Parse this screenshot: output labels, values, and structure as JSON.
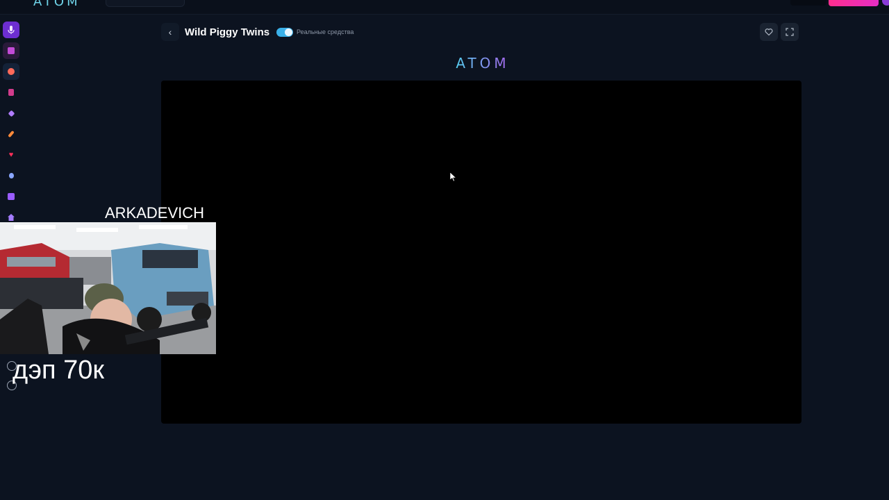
{
  "topbar": {
    "logo_text": "ATOM"
  },
  "sidebar": {
    "items": [
      {
        "icon": "mic-icon",
        "color": "#c9a3ff"
      },
      {
        "icon": "slots-icon",
        "color": "#c24bd6"
      },
      {
        "icon": "globe-icon",
        "color": "#ff6a5a"
      },
      {
        "icon": "cards-icon",
        "color": "#d23c8c"
      },
      {
        "icon": "gem-icon",
        "color": "#b07cff"
      },
      {
        "icon": "rocket-icon",
        "color": "#ff8a3a"
      },
      {
        "icon": "heart-icon",
        "color": "#ff2f5a"
      },
      {
        "icon": "potion-icon",
        "color": "#8aa6ff"
      },
      {
        "icon": "dice-icon",
        "color": "#9a5cff"
      },
      {
        "icon": "home-icon",
        "color": "#a47cff"
      }
    ]
  },
  "game": {
    "back_icon": "‹",
    "title": "Wild Piggy Twins",
    "real_money_label": "Реальные средства",
    "real_money_on": true,
    "favorite_icon": "heart-outline-icon",
    "fullscreen_icon": "fullscreen-icon",
    "provider_logo": "ATOM"
  },
  "stream_overlay": {
    "streamer_name": "ARKADEVICH",
    "caption": "дэп 70к"
  },
  "colors": {
    "background": "#0c1320",
    "accent": "#3ab0e8",
    "brand_pink": "#ff2e8e"
  }
}
